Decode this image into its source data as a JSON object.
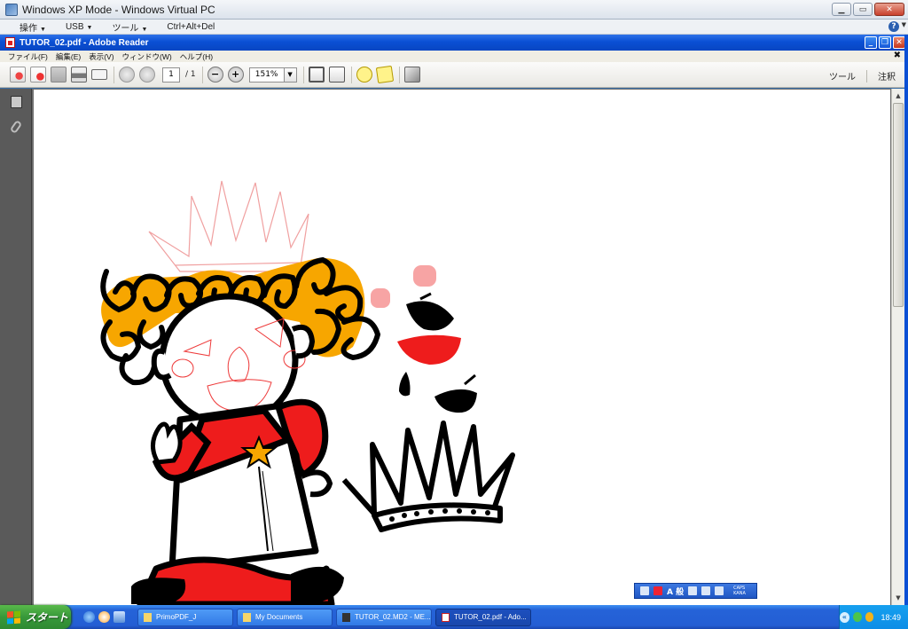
{
  "vpc": {
    "title": "Windows XP Mode - Windows Virtual PC",
    "menus": [
      "操作",
      "USB",
      "ツール",
      "Ctrl+Alt+Del"
    ]
  },
  "reader": {
    "title": "TUTOR_02.pdf - Adobe Reader",
    "menus": [
      "ファイル(F)",
      "編集(E)",
      "表示(V)",
      "ウィンドウ(W)",
      "ヘルプ(H)"
    ],
    "page_current": "1",
    "page_total": "/ 1",
    "zoom": "151%",
    "tools_label": "ツール",
    "comment_label": "注釈"
  },
  "document": {
    "colors": {
      "red": "#ee1c1c",
      "orange": "#f7a600",
      "pink": "#f7a4a4",
      "black": "#000000",
      "outline_pink": "#f0a0a0"
    }
  },
  "ime": {
    "mode_text": "A 般",
    "caps": "CAPS",
    "kana": "KANA"
  },
  "taskbar": {
    "start_label": "スタート",
    "tasks": [
      "PrimoPDF_J",
      "My Documents",
      "TUTOR_02.MD2 - ME...",
      "TUTOR_02.pdf - Ado..."
    ],
    "clock": "18:49"
  }
}
